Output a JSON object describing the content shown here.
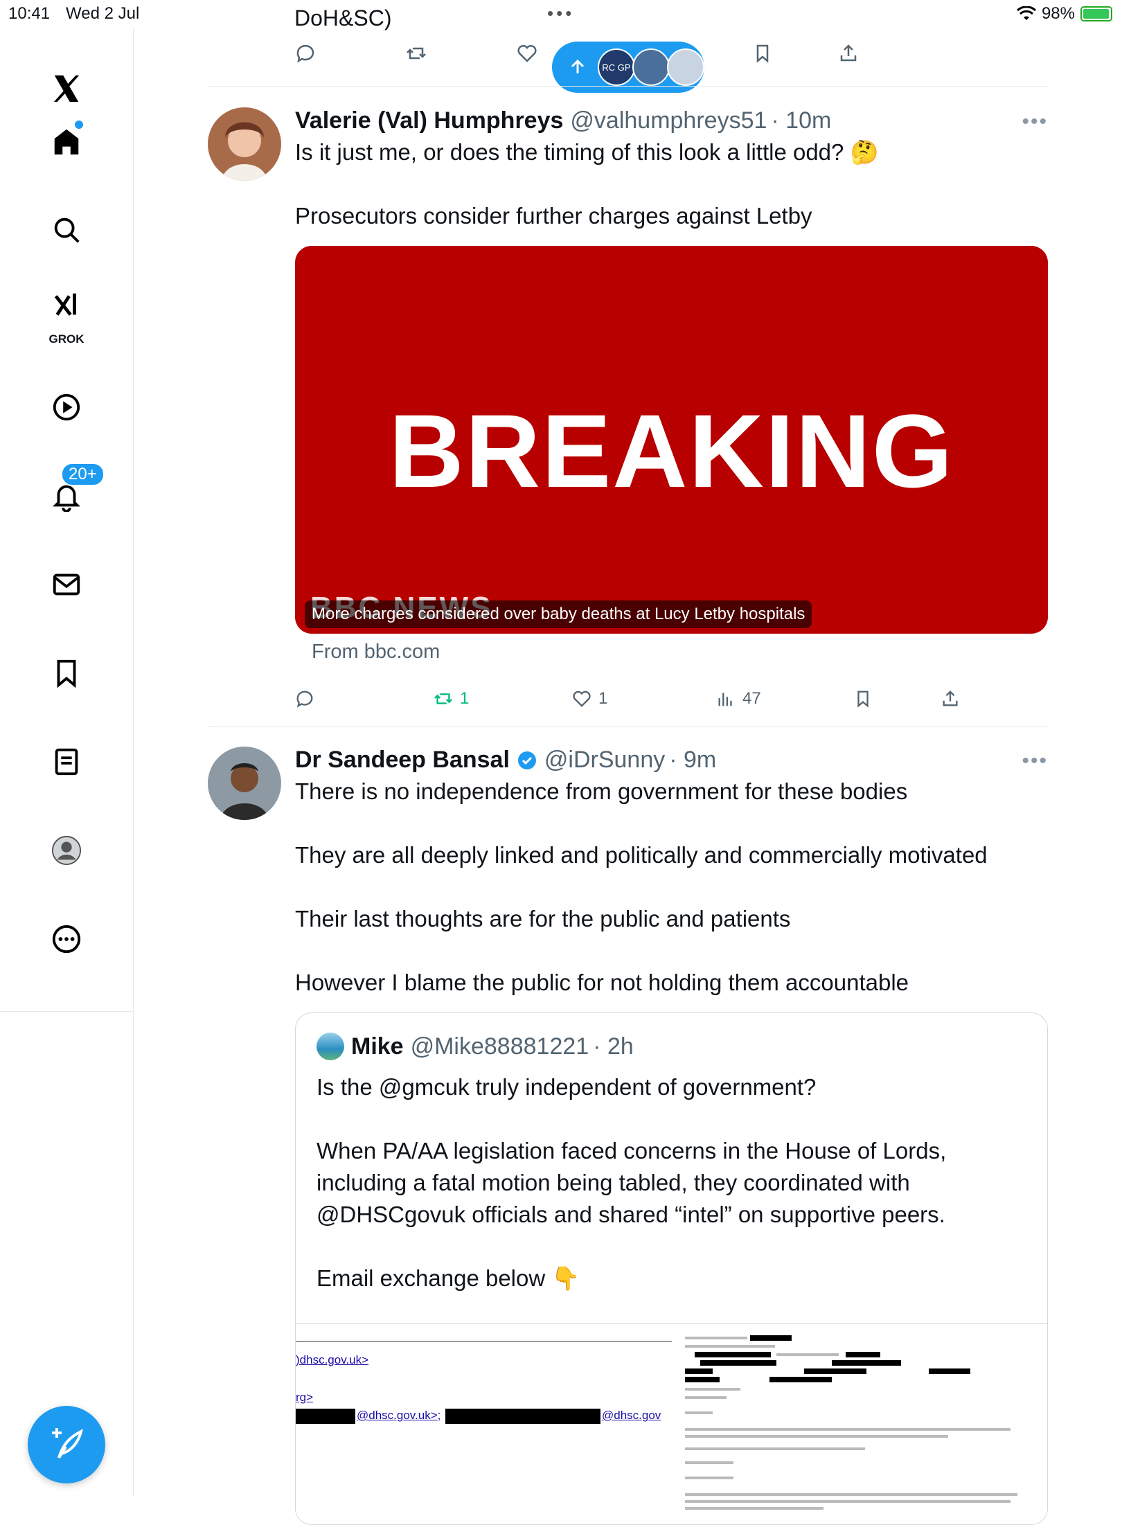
{
  "status_bar": {
    "time": "10:41",
    "date": "Wed 2 Jul",
    "battery": "98%",
    "battery_level": 0.98
  },
  "header": {
    "title": "DoH&SC)"
  },
  "new_posts_pill": {
    "avatar_1": "RC GP"
  },
  "sidebar": {
    "grok_label": "GROK",
    "notifications_badge": "20+",
    "icons": [
      "x-logo-icon",
      "home-icon",
      "search-icon",
      "grok-icon",
      "video-icon",
      "bell-icon",
      "mail-icon",
      "bookmark-icon",
      "list-icon",
      "profile-icon",
      "more-icon",
      "compose-icon"
    ]
  },
  "tweets": [
    {
      "name": "Valerie (Val) Humphreys",
      "handle": "@valhumphreys51",
      "time": "· 10m",
      "text": "Is it just me, or does the timing of this look a little odd? 🤔\n\nProsecutors consider further charges against Letby",
      "card": {
        "headline": "BREAKING",
        "brand": "BBC NEWS",
        "caption": "More charges considered over baby deaths at Lucy Letby hospitals",
        "from": "From bbc.com"
      },
      "actions": {
        "replies": "",
        "reposts": "1",
        "likes": "1",
        "views": "47"
      }
    },
    {
      "name": "Dr Sandeep Bansal",
      "handle": "@iDrSunny",
      "time": "· 9m",
      "text": "There is no independence from government for these bodies\n\nThey are all deeply linked and politically and commercially motivated\n\nTheir last thoughts are for the public and patients\n\nHowever I blame the public for not holding them accountable",
      "quote": {
        "name": "Mike",
        "handle": "@Mike88881221",
        "time": "· 2h",
        "text": "Is the @gmcuk truly independent of government?\n\nWhen PA/AA legislation faced concerns in the House of Lords, including a fatal motion being tabled, they coordinated with @DHSCgovuk officials and shared “intel” on supportive peers.\n\nEmail exchange below 👇",
        "image_left": {
          "line1": ")dhsc.gov.uk>",
          "line2": "rg>",
          "line3a": "@dhsc.gov.uk>;",
          "line3b": "@dhsc.gov"
        }
      }
    }
  ],
  "colors": {
    "accent": "#1d9bf0",
    "bbc_red": "#b80000",
    "repost_green": "#00ba7c"
  }
}
